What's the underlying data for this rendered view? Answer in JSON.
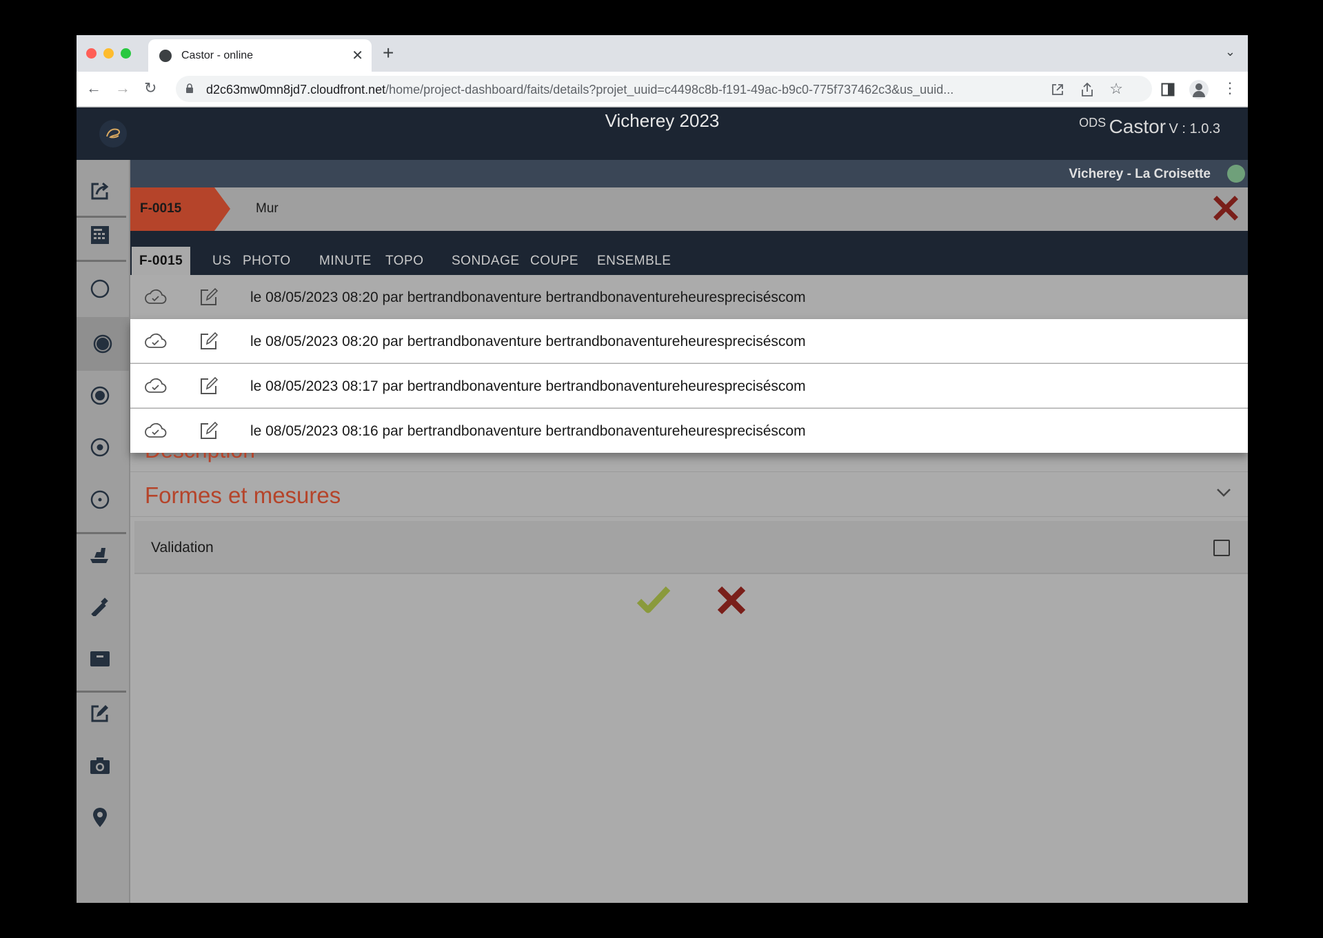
{
  "browser": {
    "tab_title": "Castor - online",
    "url_domain": "d2c63mw0mn8jd7.cloudfront.net",
    "url_path": "/home/project-dashboard/faits/details?projet_uuid=c4498c8b-f191-49ac-b9c0-775f737462c3&us_uuid..."
  },
  "app": {
    "project_title": "Vicherey 2023",
    "brand_ods": "ODS",
    "brand_name": "Castor",
    "version": "V : 1.0.3",
    "site_name": "Vicherey - La Croisette"
  },
  "fait": {
    "code": "F-0015",
    "type": "Mur"
  },
  "tabs": [
    "F-0015",
    "US",
    "PHOTO",
    "MINUTE",
    "TOPO",
    "SONDAGE",
    "COUPE",
    "ENSEMBLE"
  ],
  "history": [
    "le 08/05/2023 08:20 par bertrandbonaventure bertrandbonaventureheurespreciséscom",
    "le 08/05/2023 08:20 par bertrandbonaventure bertrandbonaventureheurespreciséscom",
    "le 08/05/2023 08:17 par bertrandbonaventure bertrandbonaventureheurespreciséscom",
    "le 08/05/2023 08:16 par bertrandbonaventure bertrandbonaventureheurespreciséscom"
  ],
  "sections": {
    "description_title": "Description",
    "formes_title": "Formes et mesures"
  },
  "validation": {
    "label": "Validation",
    "checked": false
  },
  "colors": {
    "accent": "#b5442a",
    "header_bg": "#1c2532",
    "confirm": "#8a9a3c",
    "cancel": "#7a1f1a"
  }
}
